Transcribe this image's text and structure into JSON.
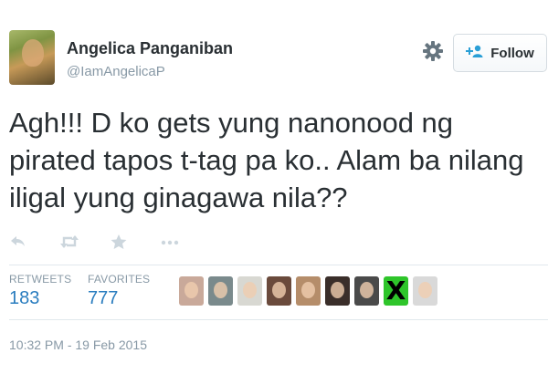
{
  "user": {
    "display_name": "Angelica Panganiban",
    "handle": "@IamAngelicaP"
  },
  "header": {
    "follow_label": "Follow"
  },
  "tweet": {
    "text": "Agh!!! D ko gets yung nanonood ng pirated tapos t-tag pa ko.. Alam ba nilang iligal yung ginagawa nila??"
  },
  "actions": [
    "reply-icon",
    "retweet-icon",
    "favorite-icon",
    "more-icon"
  ],
  "stats": {
    "retweets_label": "RETWEETS",
    "retweets_count": "183",
    "favorites_label": "FAVORITES",
    "favorites_count": "777"
  },
  "favoriters": [
    {
      "color": "#c9a99a"
    },
    {
      "color": "#7a8a8c"
    },
    {
      "color": "#d8d8d2"
    },
    {
      "color": "#6a4a3c"
    },
    {
      "color": "#b58d6a"
    },
    {
      "color": "#3a2e2a"
    },
    {
      "color": "#4a4a4a"
    },
    {
      "color": "#2ec52a",
      "glyph": "X"
    },
    {
      "color": "#d9d9d9"
    }
  ],
  "timestamp": "10:32 PM - 19 Feb 2015",
  "colors": {
    "link": "#2a7dbf",
    "muted": "#8899a6",
    "text": "#292f33",
    "divider": "#e1e8ed"
  }
}
